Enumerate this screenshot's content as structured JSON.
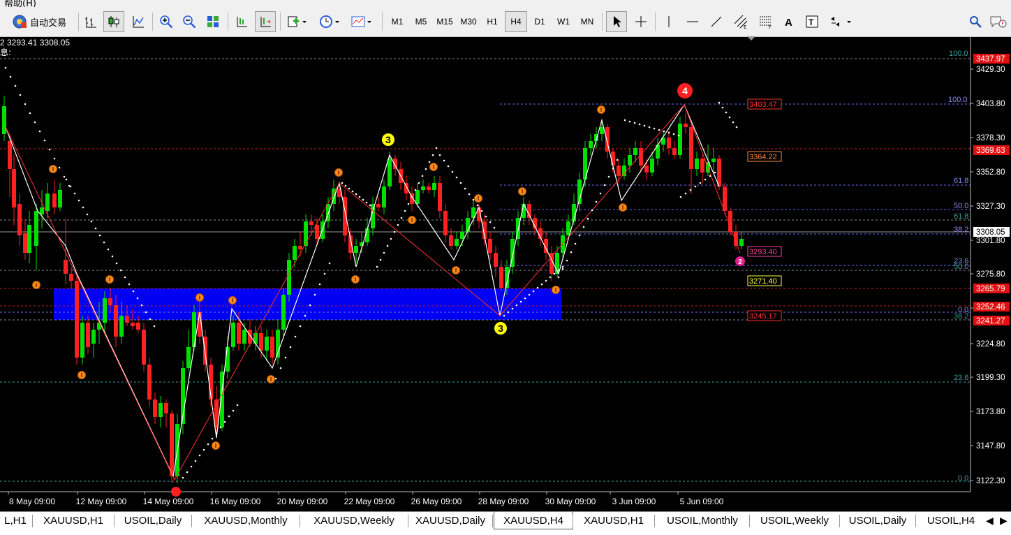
{
  "menubar": {
    "help_label": "帮助(H)"
  },
  "toolbar": {
    "autotrade_label": "自动交易",
    "timeframes": [
      "M1",
      "M5",
      "M15",
      "M30",
      "H1",
      "H4",
      "D1",
      "W1",
      "MN"
    ],
    "active_timeframe": "H4"
  },
  "chart": {
    "info_line1": "2 3293.41 3308.05",
    "info_line2": "息:",
    "price_ticks": [
      "3429.30",
      "3403.80",
      "3378.30",
      "3352.80",
      "3327.30",
      "3301.80",
      "3275.80",
      "3250.30",
      "3224.80",
      "3199.30",
      "3173.80",
      "3147.80",
      "3122.30"
    ],
    "date_ticks": [
      "8 May 09:00",
      "12 May 09:00",
      "14 May 09:00",
      "16 May 09:00",
      "20 May 09:00",
      "22 May 09:00",
      "26 May 09:00",
      "28 May 09:00",
      "30 May 09:00",
      "3 Jun 09:00",
      "5 Jun 09:00"
    ],
    "current_price": "3308.05",
    "red_price_tags": [
      "3437.97",
      "3369.63",
      "3265.79",
      "3252.46",
      "3241.27"
    ],
    "box_price_tags": [
      {
        "text": "3403.47",
        "color": "#ff3030"
      },
      {
        "text": "3364.22",
        "color": "#ff8c3a"
      },
      {
        "text": "3293.40",
        "color": "#ff40a0"
      },
      {
        "text": "3271.40",
        "color": "#ffff40"
      },
      {
        "text": "3245.17",
        "color": "#ff3030"
      }
    ],
    "fib_labels": [
      "100.0",
      "100.0",
      "61.8",
      "50.0",
      "61.8",
      "38.2",
      "23.6",
      "50.0",
      "0.0",
      "38.2",
      "23.6",
      "0.0"
    ],
    "wave_labels": [
      {
        "text": "3",
        "color": "#ffff00"
      },
      {
        "text": "3",
        "color": "#ffff00"
      },
      {
        "text": "4",
        "color": "#ff2020"
      },
      {
        "text": "2",
        "color": "#e0208c"
      }
    ],
    "colors": {
      "bull": "#00e000",
      "bear": "#ff2020",
      "zone": "#0000ff",
      "grid": "#7d7d7d"
    }
  },
  "tabs": [
    "L,H1",
    "XAUUSD,H1",
    "USOIL,Daily",
    "XAUUSD,Monthly",
    "XAUUSD,Weekly",
    "XAUUSD,Daily",
    "XAUUSD,H4",
    "XAUUSD,H1",
    "USOIL,Monthly",
    "USOIL,Weekly",
    "USOIL,Daily",
    "USOIL,H4"
  ],
  "active_tab": "XAUUSD,H4"
}
